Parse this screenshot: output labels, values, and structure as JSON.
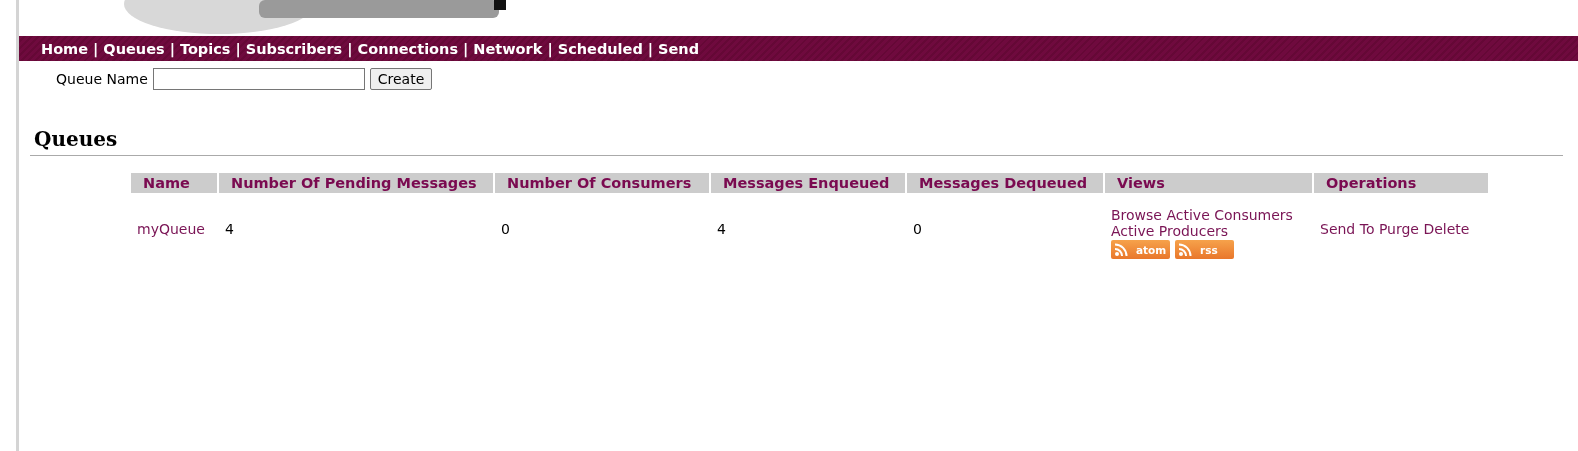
{
  "nav": {
    "separator": "|",
    "items": [
      {
        "label": "Home"
      },
      {
        "label": "Queues"
      },
      {
        "label": "Topics"
      },
      {
        "label": "Subscribers"
      },
      {
        "label": "Connections"
      },
      {
        "label": "Network"
      },
      {
        "label": "Scheduled"
      },
      {
        "label": "Send"
      }
    ]
  },
  "create_form": {
    "label": "Queue Name",
    "button": "Create"
  },
  "heading": "Queues",
  "table": {
    "columns": [
      "Name",
      "Number Of Pending Messages",
      "Number Of Consumers",
      "Messages Enqueued",
      "Messages Dequeued",
      "Views",
      "Operations"
    ],
    "rows": [
      {
        "name": "myQueue",
        "pending": "4",
        "consumers": "0",
        "enqueued": "4",
        "dequeued": "0",
        "views": [
          "Browse",
          "Active Consumers",
          "Active Producers"
        ],
        "feeds": [
          "atom",
          "rss"
        ],
        "operations": [
          "Send To",
          "Purge",
          "Delete"
        ]
      }
    ]
  }
}
